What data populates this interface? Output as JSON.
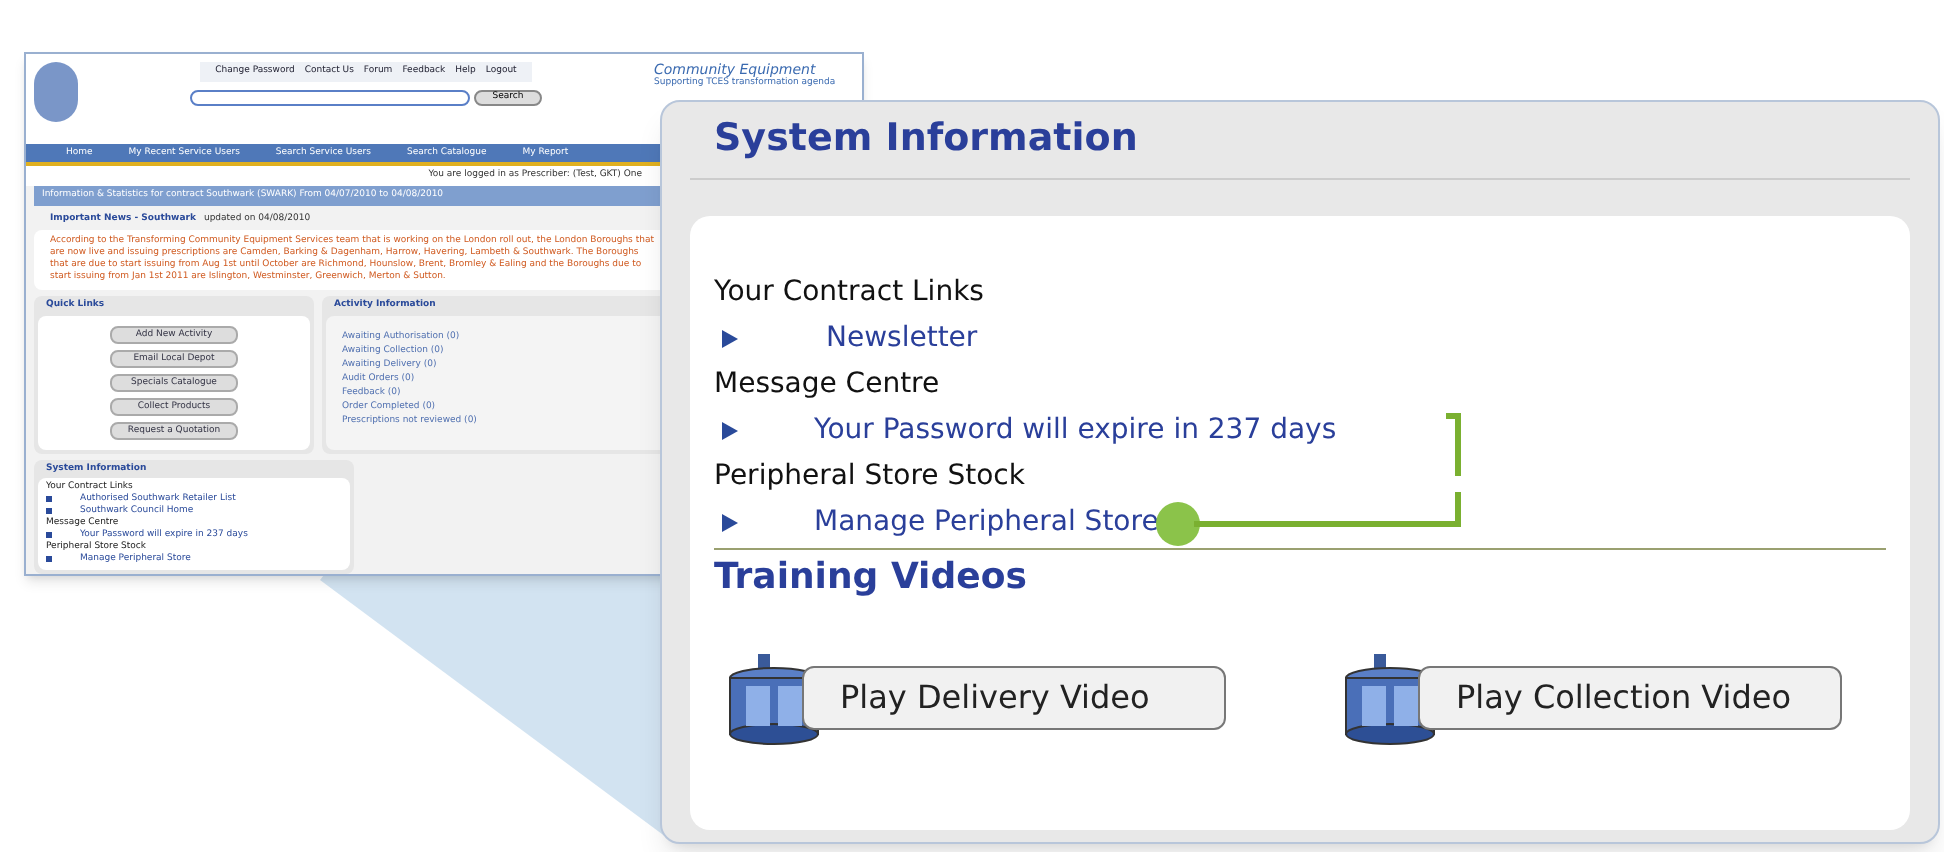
{
  "mini_page": {
    "header_links": [
      "Change Password",
      "Contact Us",
      "Forum",
      "Feedback",
      "Help",
      "Logout"
    ],
    "search_button": "Search",
    "brand": {
      "title": "Community Equipment",
      "subtitle": "Supporting TCES transformation agenda"
    },
    "nav": [
      "Home",
      "My Recent Service Users",
      "Search Service Users",
      "Search Catalogue",
      "My Report"
    ],
    "login_note": "You are logged in as Prescriber: (Test, GKT) One",
    "info_bar": "Information & Statistics for contract Southwark (SWARK) From 04/07/2010 to 04/08/2010",
    "news": {
      "title": "Important News - Southwark",
      "updated": "updated on 04/08/2010",
      "body": "According to the Transforming Community Equipment Services team that is working on the London roll out, the London Boroughs that are now live and issuing prescriptions are Camden, Barking & Dagenham, Harrow, Havering, Lambeth & Southwark. The Boroughs that are due to start issuing from Aug 1st until October are Richmond, Hounslow, Brent, Bromley & Ealing and the Boroughs due to start issuing from Jan 1st 2011 are Islington, Westminster, Greenwich, Merton & Sutton."
    },
    "quick_links": {
      "title": "Quick Links",
      "buttons": [
        "Add New Activity",
        "Email Local Depot",
        "Specials Catalogue",
        "Collect Products",
        "Request a Quotation"
      ]
    },
    "activity": {
      "title": "Activity Information",
      "items": [
        "Awaiting Authorisation (0)",
        "Awaiting Collection (0)",
        "Awaiting Delivery (0)",
        "Audit Orders (0)",
        "Feedback (0)",
        "Order Completed (0)",
        "Prescriptions not reviewed (0)"
      ]
    },
    "system_info": {
      "title": "System Information",
      "sections": [
        {
          "heading": "Your Contract Links",
          "links": [
            "Authorised Southwark Retailer List",
            "Southwark Council Home"
          ]
        },
        {
          "heading": "Message Centre",
          "links": [
            "Your Password will expire in 237 days"
          ]
        },
        {
          "heading": "Peripheral Store Stock",
          "links": [
            "Manage Peripheral Store"
          ]
        }
      ]
    }
  },
  "zoom_panel": {
    "title": "System Information",
    "sections": [
      {
        "heading": "Your Contract Links",
        "links": [
          "Newsletter"
        ]
      },
      {
        "heading": "Message Centre",
        "links": [
          "Your Password will expire in 237 days"
        ]
      },
      {
        "heading": "Peripheral Store Stock",
        "links": [
          "Manage Peripheral Store"
        ]
      }
    ],
    "training": {
      "title": "Training Videos",
      "videos": [
        "Play Delivery Video",
        "Play Collection Video"
      ]
    }
  }
}
